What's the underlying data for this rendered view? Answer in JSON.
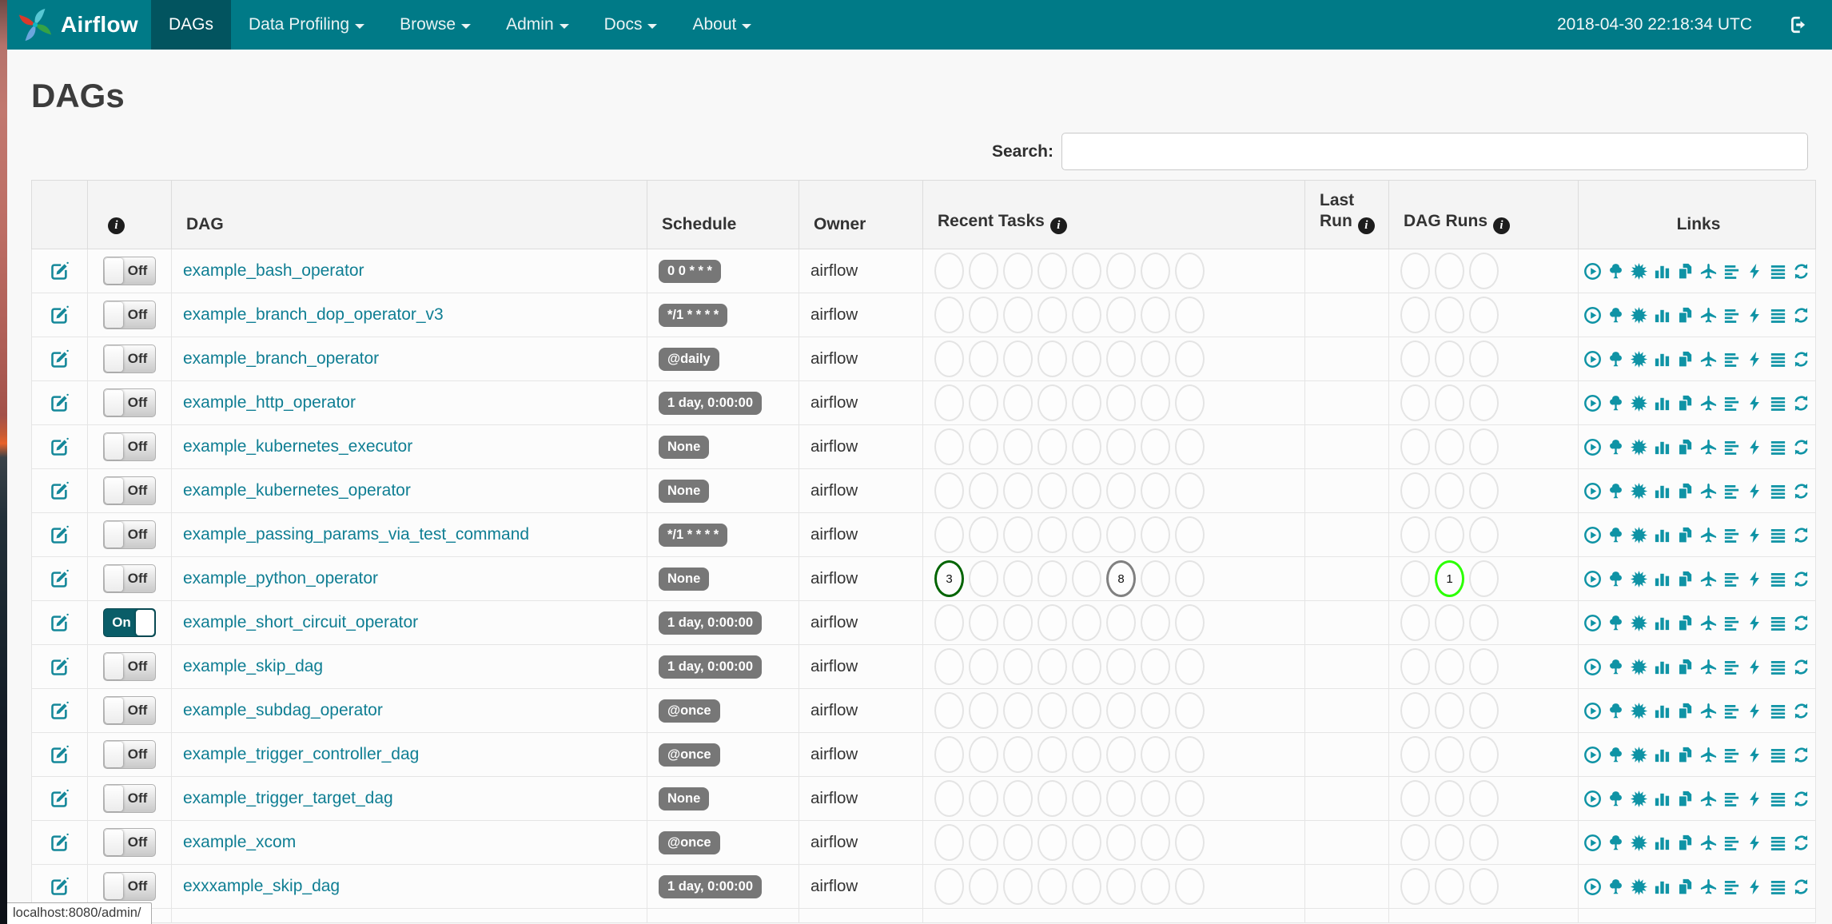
{
  "colors": {
    "navbar_bg": "#007a87",
    "navbar_active_bg": "#02545f",
    "link_teal": "#0f7e93",
    "icon_teal": "#0f93a5",
    "toggle_on_bg": "#0a5d68",
    "schedule_badge_bg": "#777777",
    "task_success_border": "#006400",
    "task_no_status_border": "#808080",
    "dagrun_running_border": "#2bff00",
    "empty_circle_border": "#e4e4e4"
  },
  "navbar": {
    "brand": "Airflow",
    "logo_icon": "airflow-pinwheel-logo",
    "items": [
      {
        "label": "DAGs",
        "active": true,
        "caret": false
      },
      {
        "label": "Data Profiling",
        "active": false,
        "caret": true
      },
      {
        "label": "Browse",
        "active": false,
        "caret": true
      },
      {
        "label": "Admin",
        "active": false,
        "caret": true
      },
      {
        "label": "Docs",
        "active": false,
        "caret": true
      },
      {
        "label": "About",
        "active": false,
        "caret": true
      }
    ],
    "clock": "2018-04-30 22:18:34 UTC",
    "logout_icon": "logout-icon"
  },
  "page": {
    "title": "DAGs",
    "search_label": "Search:",
    "search_value": "",
    "status_bar_url": "localhost:8080/admin/"
  },
  "table": {
    "headers": {
      "dag": "DAG",
      "schedule": "Schedule",
      "owner": "Owner",
      "recent_tasks": "Recent Tasks",
      "last_run_line1": "Last",
      "last_run_line2": "Run",
      "dag_runs": "DAG Runs",
      "links": "Links"
    },
    "recent_task_slots": 8,
    "dag_run_slots": 3,
    "toggle_labels": {
      "on": "On",
      "off": "Off"
    },
    "links": [
      {
        "icon": "trigger-dag",
        "label": "Trigger Dag"
      },
      {
        "icon": "tree-view",
        "label": "Tree View"
      },
      {
        "icon": "graph-view",
        "label": "Graph View"
      },
      {
        "icon": "task-duration",
        "label": "Task Duration"
      },
      {
        "icon": "task-tries",
        "label": "Task Tries"
      },
      {
        "icon": "landing-times",
        "label": "Landing Times"
      },
      {
        "icon": "gantt",
        "label": "Gantt"
      },
      {
        "icon": "code",
        "label": "Code"
      },
      {
        "icon": "logs",
        "label": "Logs"
      },
      {
        "icon": "refresh",
        "label": "Refresh"
      }
    ],
    "rows": [
      {
        "name": "example_bash_operator",
        "toggle": "Off",
        "schedule": "0 0 * * *",
        "owner": "airflow",
        "recent_tasks": [],
        "dag_runs": []
      },
      {
        "name": "example_branch_dop_operator_v3",
        "toggle": "Off",
        "schedule": "*/1 * * * *",
        "owner": "airflow",
        "recent_tasks": [],
        "dag_runs": []
      },
      {
        "name": "example_branch_operator",
        "toggle": "Off",
        "schedule": "@daily",
        "owner": "airflow",
        "recent_tasks": [],
        "dag_runs": []
      },
      {
        "name": "example_http_operator",
        "toggle": "Off",
        "schedule": "1 day, 0:00:00",
        "owner": "airflow",
        "recent_tasks": [],
        "dag_runs": []
      },
      {
        "name": "example_kubernetes_executor",
        "toggle": "Off",
        "schedule": "None",
        "owner": "airflow",
        "recent_tasks": [],
        "dag_runs": []
      },
      {
        "name": "example_kubernetes_operator",
        "toggle": "Off",
        "schedule": "None",
        "owner": "airflow",
        "recent_tasks": [],
        "dag_runs": []
      },
      {
        "name": "example_passing_params_via_test_command",
        "toggle": "Off",
        "schedule": "*/1 * * * *",
        "owner": "airflow",
        "recent_tasks": [],
        "dag_runs": []
      },
      {
        "name": "example_python_operator",
        "toggle": "Off",
        "schedule": "None",
        "owner": "airflow",
        "recent_tasks": [
          {
            "slot": 0,
            "value": "3",
            "state": "success"
          },
          {
            "slot": 5,
            "value": "8",
            "state": "no_status"
          }
        ],
        "dag_runs": [
          {
            "slot": 1,
            "value": "1",
            "state": "running"
          }
        ]
      },
      {
        "name": "example_short_circuit_operator",
        "toggle": "On",
        "schedule": "1 day, 0:00:00",
        "owner": "airflow",
        "recent_tasks": [],
        "dag_runs": []
      },
      {
        "name": "example_skip_dag",
        "toggle": "Off",
        "schedule": "1 day, 0:00:00",
        "owner": "airflow",
        "recent_tasks": [],
        "dag_runs": []
      },
      {
        "name": "example_subdag_operator",
        "toggle": "Off",
        "schedule": "@once",
        "owner": "airflow",
        "recent_tasks": [],
        "dag_runs": []
      },
      {
        "name": "example_trigger_controller_dag",
        "toggle": "Off",
        "schedule": "@once",
        "owner": "airflow",
        "recent_tasks": [],
        "dag_runs": []
      },
      {
        "name": "example_trigger_target_dag",
        "toggle": "Off",
        "schedule": "None",
        "owner": "airflow",
        "recent_tasks": [],
        "dag_runs": []
      },
      {
        "name": "example_xcom",
        "toggle": "Off",
        "schedule": "@once",
        "owner": "airflow",
        "recent_tasks": [],
        "dag_runs": []
      },
      {
        "name": "exxxample_skip_dag",
        "toggle": "Off",
        "schedule": "1 day, 0:00:00",
        "owner": "airflow",
        "recent_tasks": [],
        "dag_runs": []
      }
    ]
  }
}
